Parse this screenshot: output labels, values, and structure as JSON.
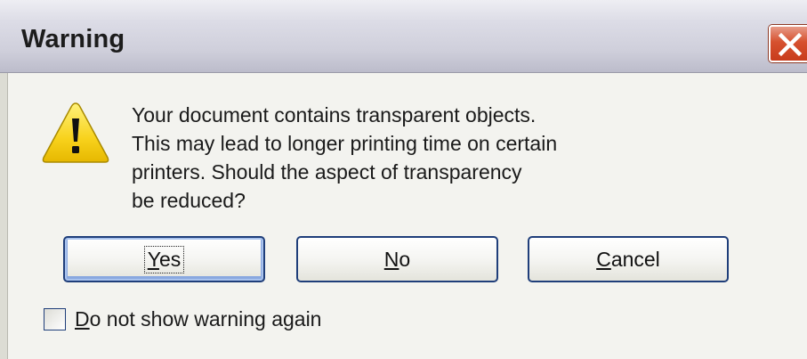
{
  "dialog": {
    "title": "Warning",
    "icon": "warning-icon",
    "message_lines": [
      "Your document contains transparent objects.",
      "This may lead to longer printing time on certain",
      "printers. Should the aspect of transparency",
      "be reduced?"
    ],
    "buttons": {
      "yes": {
        "mnemonic": "Y",
        "rest": "es"
      },
      "no": {
        "mnemonic": "N",
        "rest": "o"
      },
      "cancel": {
        "mnemonic": "C",
        "rest": "ancel"
      }
    },
    "checkbox": {
      "mnemonic": "D",
      "rest": "o not show warning again",
      "checked": false
    },
    "close_icon": "close-icon",
    "colors": {
      "close_button": "#d6512f",
      "warning_yellow": "#f8d21c",
      "button_border": "#1f3e7a"
    }
  }
}
